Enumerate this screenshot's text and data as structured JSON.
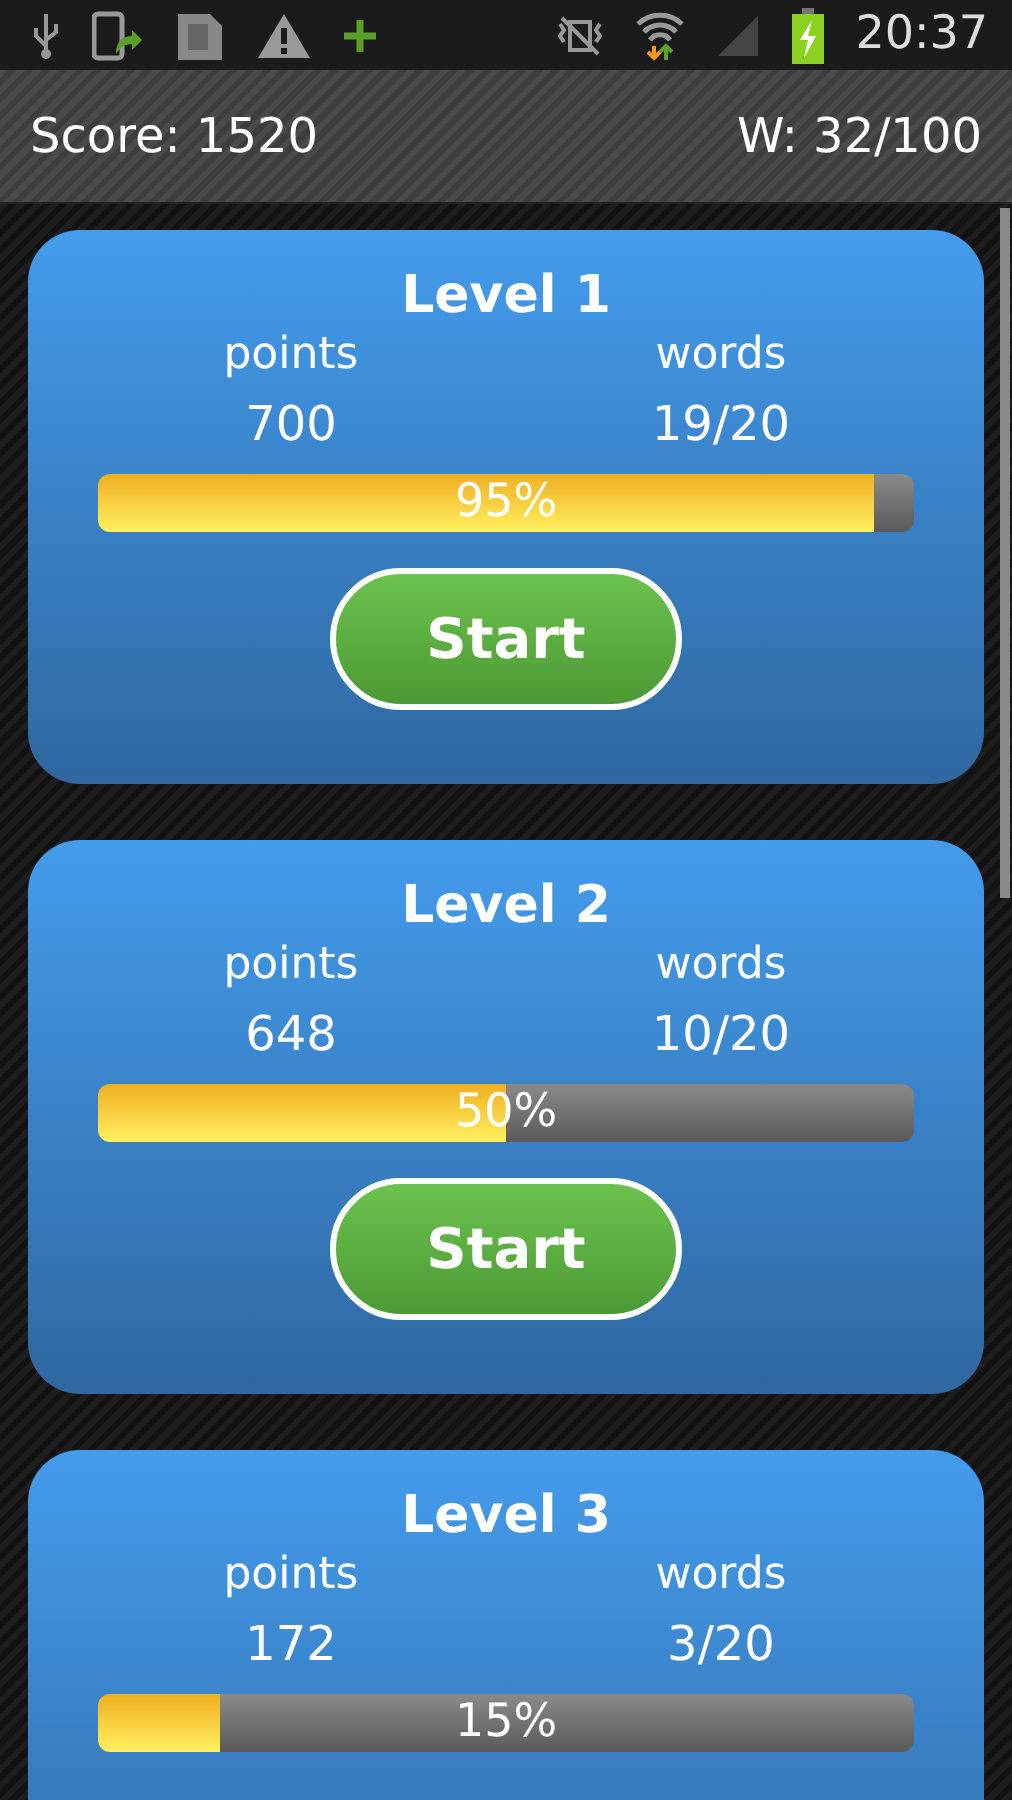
{
  "status_bar": {
    "time": "20:37"
  },
  "header": {
    "score": "Score: 1520",
    "words": "W: 32/100"
  },
  "levels": [
    {
      "title": "Level 1",
      "points_label": "points",
      "words_label": "words",
      "points": "700",
      "words": "19/20",
      "level": 0.95,
      "percent": "95%",
      "button": "Start"
    },
    {
      "title": "Level 2",
      "points_label": "points",
      "words_label": "words",
      "points": "648",
      "words": "10/20",
      "level": 0.5,
      "percent": "50%",
      "button": "Start"
    },
    {
      "title": "Level 3",
      "points_label": "points",
      "words_label": "words",
      "points": "172",
      "words": "3/20",
      "level": 0.15,
      "percent": "15%"
    }
  ]
}
